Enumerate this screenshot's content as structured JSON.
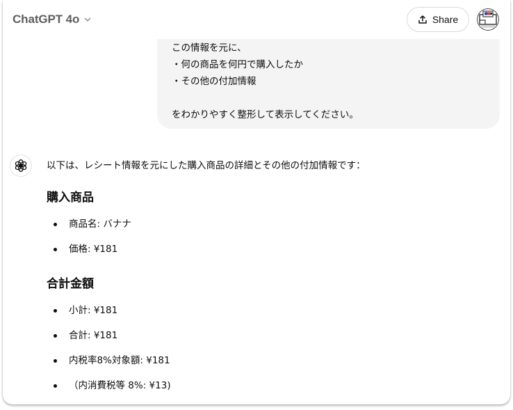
{
  "header": {
    "model_name": "ChatGPT 4o",
    "share_label": "Share"
  },
  "user_message": {
    "lines": [
      "この情報を元に、",
      "・何の商品を何円で購入したか",
      "・その他の付加情報",
      "",
      "をわかりやすく整形して表示してください。"
    ]
  },
  "assistant_message": {
    "intro": "以下は、レシート情報を元にした購入商品の詳細とその他の付加情報です：",
    "sections": [
      {
        "heading": "購入商品",
        "items": [
          "商品名: バナナ",
          "価格: ¥181"
        ]
      },
      {
        "heading": "合計金額",
        "items": [
          "小計: ¥181",
          "合計: ¥181",
          "内税率8%対象額: ¥181",
          "（内消費税等 8%: ¥13)"
        ]
      }
    ]
  },
  "icons": {
    "model_chevron": "chevron-down-icon",
    "share": "share-upload-icon",
    "assistant_avatar": "openai-logo-icon",
    "user_avatar": "user-avatar"
  }
}
